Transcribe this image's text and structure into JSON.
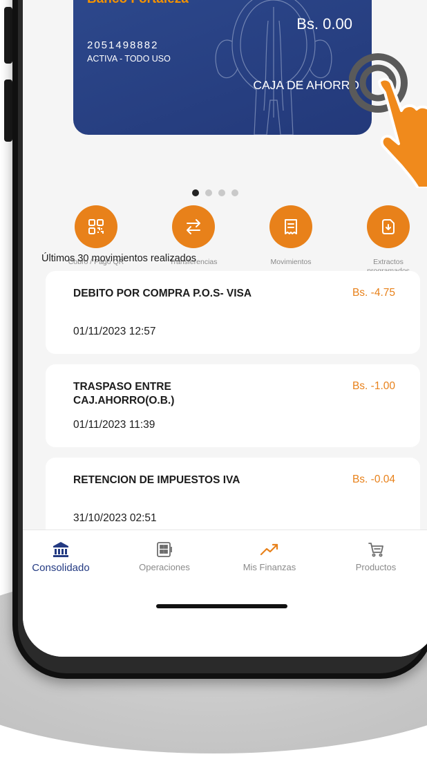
{
  "card": {
    "brand": "Banco Fortaleza",
    "balance": "Bs. 0.00",
    "account_number": "2051498882",
    "status": "ACTIVA - TODO USO",
    "account_type": "CAJA DE AHORRO"
  },
  "carousel": {
    "pages": 4,
    "active_index": 0
  },
  "actions": [
    {
      "label": "Cobro / Pago QR",
      "icon": "qr-code-icon"
    },
    {
      "label": "Transferencias",
      "icon": "transfer-arrows-icon"
    },
    {
      "label": "Movimientos",
      "icon": "receipt-icon"
    },
    {
      "label": "Extractos\nprogramados",
      "icon": "download-document-icon"
    }
  ],
  "movements": {
    "title": "Últimos 30 movimientos realizados",
    "items": [
      {
        "description": "DEBITO POR COMPRA P.O.S- VISA",
        "date": "01/11/2023 12:57",
        "amount": "Bs. -4.75"
      },
      {
        "description": "TRASPASO ENTRE CAJ.AHORRO(O.B.)",
        "date": "01/11/2023 11:39",
        "amount": "Bs. -1.00"
      },
      {
        "description": "RETENCION DE IMPUESTOS IVA",
        "date": "31/10/2023 02:51",
        "amount": "Bs. -0.04"
      }
    ]
  },
  "bottom_nav": {
    "items": [
      {
        "label": "Consolidado",
        "icon": "bank-icon",
        "active": true
      },
      {
        "label": "Operaciones",
        "icon": "calculator-icon",
        "active": false
      },
      {
        "label": "Mis Finanzas",
        "icon": "trend-up-icon",
        "active": false
      },
      {
        "label": "Productos",
        "icon": "cart-icon",
        "active": false
      }
    ]
  },
  "colors": {
    "accent": "#e8811a",
    "brand_blue": "#233a82",
    "card_blue": "#2a4486"
  }
}
